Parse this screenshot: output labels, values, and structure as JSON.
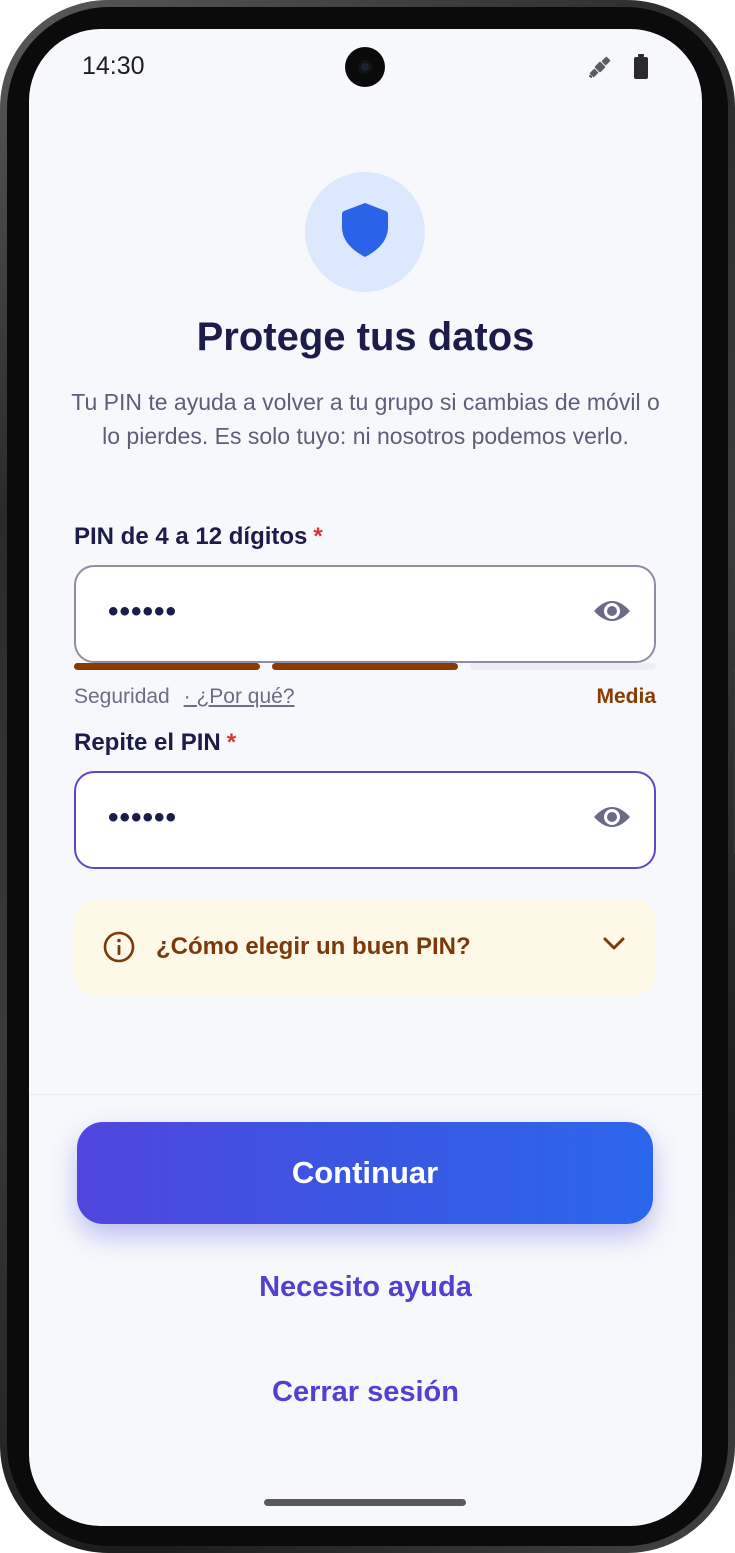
{
  "status_bar": {
    "time": "14:30",
    "icons": [
      "satellite-icon",
      "battery-icon"
    ]
  },
  "header": {
    "icon": "shield-icon",
    "title": "Protege tus datos",
    "subtitle": "Tu PIN te ayuda a volver a tu grupo si cambias de móvil o lo pierdes. Es solo tuyo: ni nosotros podemos verlo."
  },
  "pin_field": {
    "label": "PIN de 4 a 12 dígitos",
    "required_mark": "*",
    "value": "••••••",
    "toggle_icon": "eye-icon"
  },
  "strength": {
    "label": "Seguridad",
    "separator": "·",
    "why_link": "¿Por qué?",
    "level": "Media",
    "filled_segments": 2,
    "total_segments": 3
  },
  "repeat_field": {
    "label": "Repite el PIN",
    "required_mark": "*",
    "value": "••••••",
    "toggle_icon": "eye-icon"
  },
  "tip": {
    "icon": "info-icon",
    "text": "¿Cómo elegir un buen PIN?",
    "chevron": "chevron-down-icon"
  },
  "actions": {
    "continue_label": "Continuar",
    "help_label": "Necesito ayuda",
    "logout_label": "Cerrar sesión"
  },
  "colors": {
    "accent": "#5340d3",
    "title": "#1c1c4b",
    "strength_fill": "#8a3b00",
    "tip_background": "#fef8e7",
    "button_gradient_start": "#5046de",
    "button_gradient_end": "#2c66ec"
  }
}
